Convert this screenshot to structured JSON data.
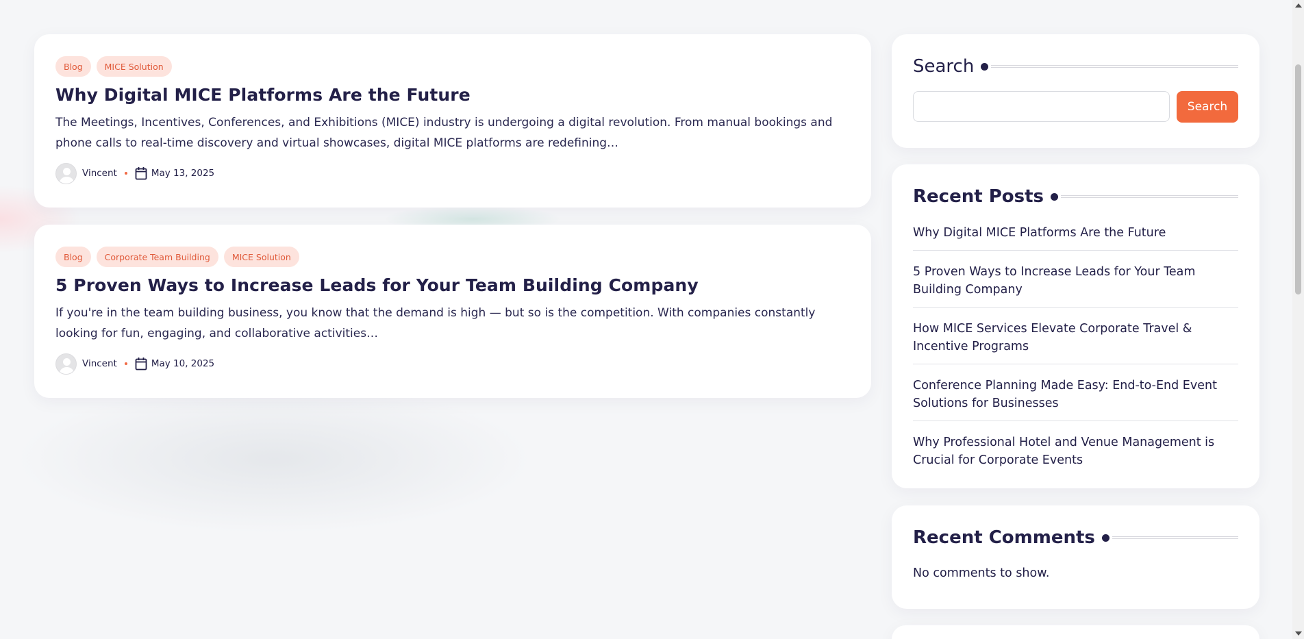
{
  "posts": [
    {
      "tags": [
        "Blog",
        "MICE Solution"
      ],
      "title": "Why Digital MICE Platforms Are the Future",
      "excerpt": "The Meetings, Incentives, Conferences, and Exhibitions (MICE) industry is undergoing a digital revolution. From manual bookings and phone calls to real-time discovery and virtual showcases, digital MICE platforms are redefining…",
      "author": "Vincent",
      "date": "May 13, 2025"
    },
    {
      "tags": [
        "Blog",
        "Corporate Team Building",
        "MICE Solution"
      ],
      "title": "5 Proven Ways to Increase Leads for Your Team Building Company",
      "excerpt": "If you're in the team building business, you know that the demand is high — but so is the competition. With companies constantly looking for fun, engaging, and collaborative activities…",
      "author": "Vincent",
      "date": "May 10, 2025"
    }
  ],
  "sidebar": {
    "search": {
      "title": "Search",
      "button_label": "Search",
      "input_value": ""
    },
    "recent_posts": {
      "title": "Recent Posts",
      "items": [
        "Why Digital MICE Platforms Are the Future",
        "5 Proven Ways to Increase Leads for Your Team Building Company",
        "How MICE Services Elevate Corporate Travel & Incentive Programs",
        "Conference Planning Made Easy: End-to-End Event Solutions for Businesses",
        "Why Professional Hotel and Venue Management is Crucial for Corporate Events"
      ]
    },
    "recent_comments": {
      "title": "Recent Comments",
      "empty_text": "No comments to show."
    }
  },
  "colors": {
    "accent": "#f26a3d",
    "tag_bg": "#fde3dd",
    "heading": "#232048",
    "background": "#f5f6f8"
  }
}
